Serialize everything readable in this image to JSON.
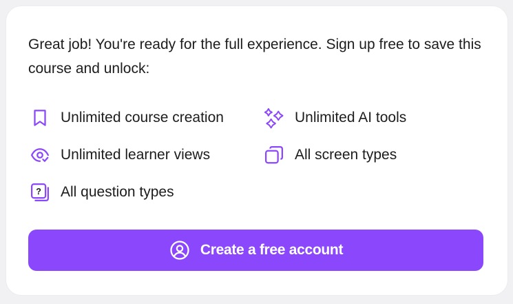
{
  "colors": {
    "accent": "#8b47fb",
    "icon": "#8b47fb",
    "text": "#1c1c1c",
    "card_bg": "#ffffff",
    "page_bg": "#f1f1f4"
  },
  "intro": {
    "text": "Great job! You're ready for the full experience. Sign up free to save this course and unlock:"
  },
  "features": [
    {
      "icon": "bookmark-icon",
      "label": "Unlimited course creation"
    },
    {
      "icon": "sparkles-icon",
      "label": "Unlimited AI tools"
    },
    {
      "icon": "eye-icon",
      "label": "Unlimited learner views"
    },
    {
      "icon": "screens-icon",
      "label": "All screen types"
    },
    {
      "icon": "question-icon",
      "label": "All question types"
    }
  ],
  "cta": {
    "icon": "user-circle-icon",
    "label": "Create a free account"
  }
}
